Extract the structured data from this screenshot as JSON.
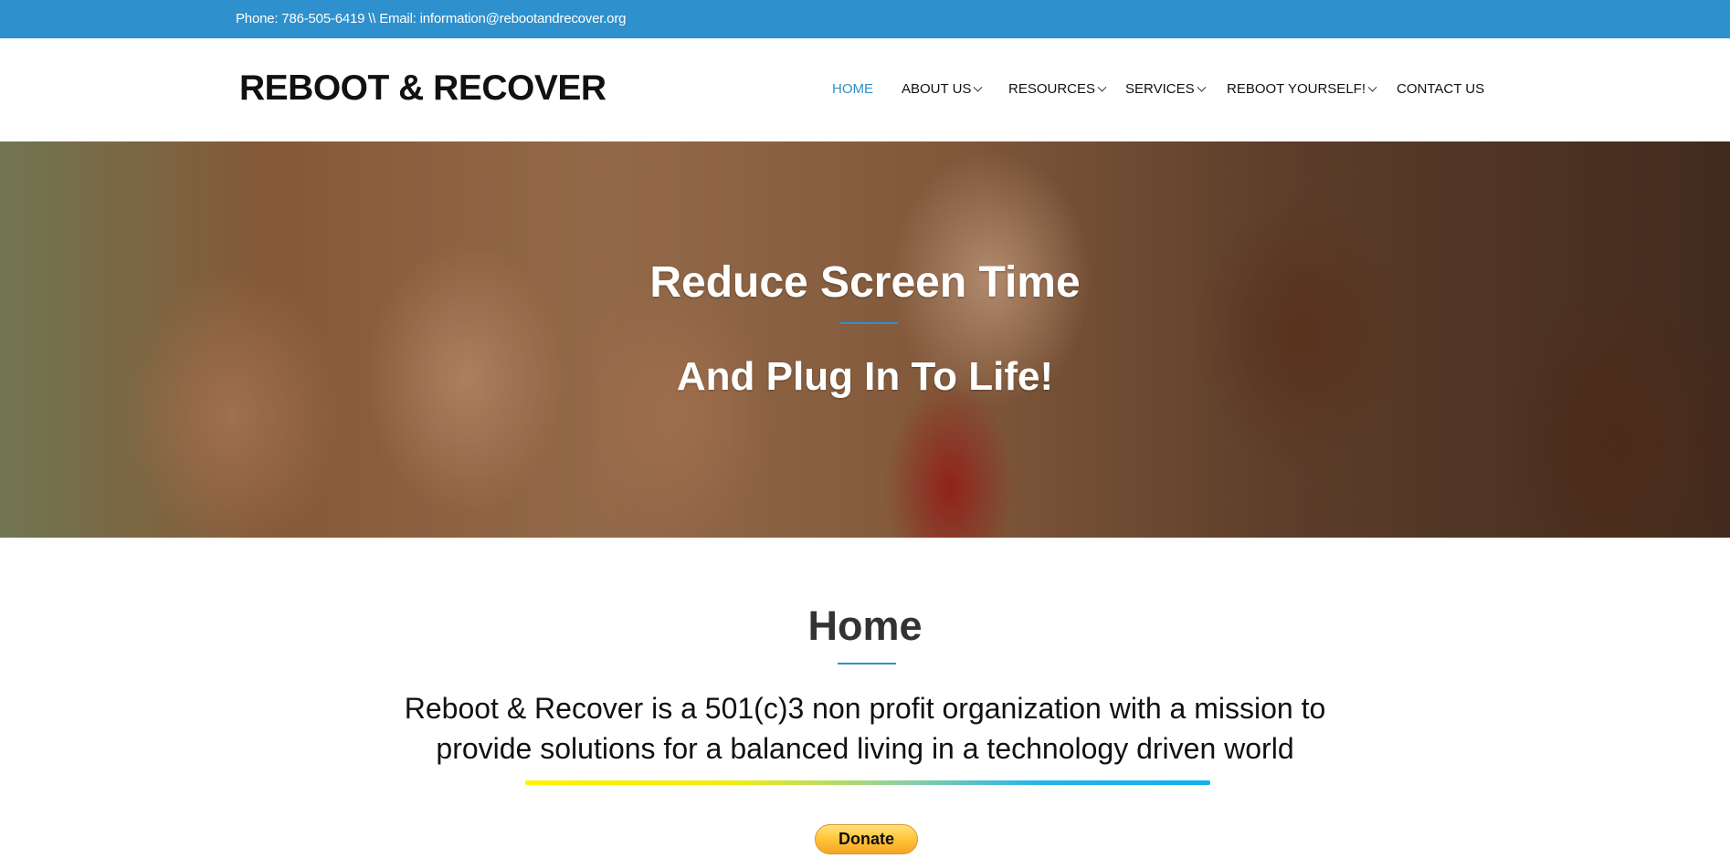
{
  "topbar": {
    "contact_text": "Phone: 786-505-6419 \\\\ Email: information@rebootandrecover.org"
  },
  "header": {
    "logo": "REBOOT & RECOVER"
  },
  "nav": {
    "items": [
      {
        "label": "HOME",
        "active": true,
        "has_dropdown": false
      },
      {
        "label": "ABOUT US",
        "active": false,
        "has_dropdown": true
      },
      {
        "label": "RESOURCES",
        "active": false,
        "has_dropdown": true
      },
      {
        "label": "SERVICES",
        "active": false,
        "has_dropdown": true
      },
      {
        "label": "REBOOT YOURSELF!",
        "active": false,
        "has_dropdown": true
      },
      {
        "label": "CONTACT US",
        "active": false,
        "has_dropdown": false
      }
    ]
  },
  "hero": {
    "title": "Reduce Screen Time",
    "subtitle": "And Plug In To Life!"
  },
  "content": {
    "title": "Home",
    "mission_line1": "Reboot & Recover is a 501(c)3  non profit organization with a mission to",
    "mission_line2": "provide solutions for a balanced living in a technology driven world",
    "donate_label": "Donate"
  },
  "colors": {
    "accent": "#2e90cc",
    "topbar": "#2e90cc",
    "donate": "#ffc439"
  }
}
